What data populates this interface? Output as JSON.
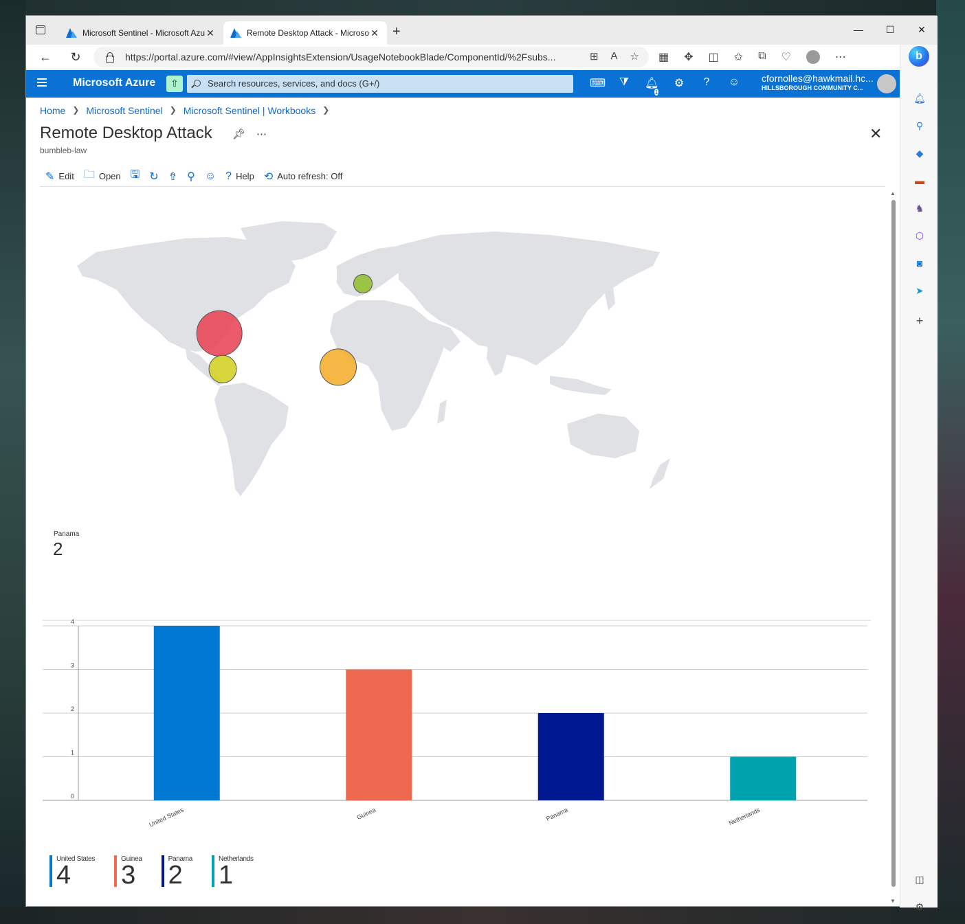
{
  "browser": {
    "tabs": [
      {
        "title": "Microsoft Sentinel - Microsoft Azure",
        "active": false
      },
      {
        "title": "Remote Desktop Attack - Microsoft Azure",
        "active": true
      }
    ],
    "url": "https://portal.azure.com/#view/AppInsightsExtension/UsageNotebookBlade/ComponentId/%2Fsubs..."
  },
  "azure": {
    "brand": "Microsoft Azure",
    "search_placeholder": "Search resources, services, and docs (G+/)",
    "notification_count": "1",
    "account_email": "cfornolles@hawkmail.hc...",
    "account_org": "HILLSBOROUGH COMMUNITY C..."
  },
  "breadcrumb": [
    "Home",
    "Microsoft Sentinel",
    "Microsoft Sentinel | Workbooks"
  ],
  "page": {
    "title": "Remote Desktop Attack",
    "subtitle": "bumbleb-law"
  },
  "toolbar": {
    "edit": "Edit",
    "open": "Open",
    "help": "Help",
    "auto_refresh": "Auto refresh: Off"
  },
  "map": {
    "points": [
      {
        "country": "United States",
        "lat": 27,
        "lon": -82,
        "count": 4,
        "color": "#e8485a"
      },
      {
        "country": "Guinea",
        "lat": 10,
        "lon": -10,
        "count": 3,
        "color": "#f5b030"
      },
      {
        "country": "Panama",
        "lat": 9,
        "lon": -80,
        "count": 2,
        "color": "#d4d228"
      },
      {
        "country": "Netherlands",
        "lat": 52,
        "lon": 5,
        "count": 1,
        "color": "#94c034"
      }
    ],
    "tooltip_country": "Panama",
    "tooltip_value": "2"
  },
  "chart_data": {
    "type": "bar",
    "categories": [
      "United States",
      "Guinea",
      "Panama",
      "Netherlands"
    ],
    "values": [
      4,
      3,
      2,
      1
    ],
    "colors": [
      "#0078d4",
      "#ef6950",
      "#00188f",
      "#00a2ad"
    ],
    "ylim": [
      0,
      4
    ],
    "yticks": [
      0,
      1,
      2,
      3,
      4
    ],
    "grid": true
  },
  "legend": [
    {
      "name": "United States",
      "value": "4",
      "color": "#0078d4"
    },
    {
      "name": "Guinea",
      "value": "3",
      "color": "#ef6950"
    },
    {
      "name": "Panama",
      "value": "2",
      "color": "#00188f"
    },
    {
      "name": "Netherlands",
      "value": "1",
      "color": "#00a2ad"
    }
  ]
}
